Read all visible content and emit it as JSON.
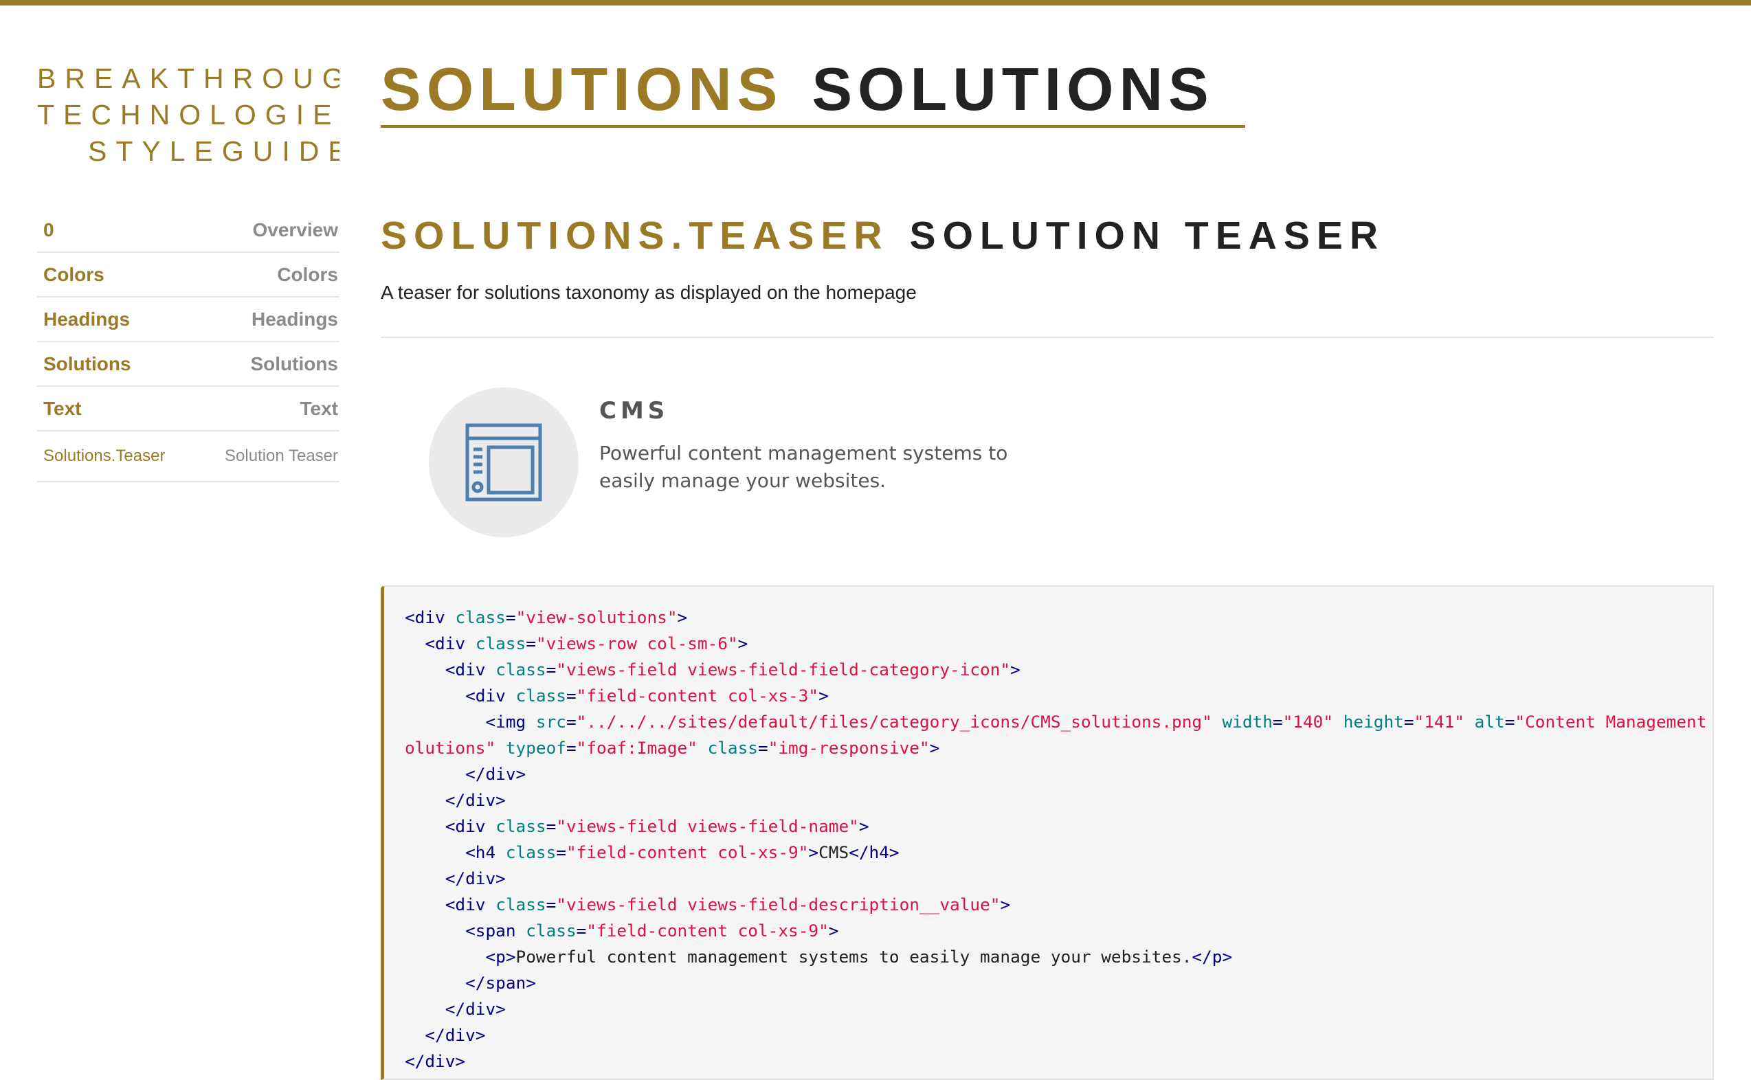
{
  "brand": {
    "line1": "BREAKTHROUGH",
    "line2": "TECHNOLOGIES",
    "line3": "STYLEGUIDE"
  },
  "nav": [
    {
      "key": "0",
      "label": "Overview"
    },
    {
      "key": "Colors",
      "label": "Colors"
    },
    {
      "key": "Headings",
      "label": "Headings"
    },
    {
      "key": "Solutions",
      "label": "Solutions"
    },
    {
      "key": "Text",
      "label": "Text"
    },
    {
      "key": "Solutions.Teaser",
      "label": "Solution Teaser"
    }
  ],
  "page": {
    "key": "SOLUTIONS",
    "title": "SOLUTIONS"
  },
  "section": {
    "key": "SOLUTIONS.TEASER",
    "title": "SOLUTION TEASER",
    "description": "A teaser for solutions taxonomy as displayed on the homepage"
  },
  "teaser": {
    "icon": "cms-window-icon",
    "title": "CMS",
    "text": "Powerful content management systems to easily manage your websites."
  },
  "code": {
    "lines": [
      [
        {
          "t": "tg",
          "v": "<div "
        },
        {
          "t": "at",
          "v": "class"
        },
        {
          "t": "tg",
          "v": "="
        },
        {
          "t": "vl",
          "v": "\"view-solutions\""
        },
        {
          "t": "tg",
          "v": ">"
        }
      ],
      [
        {
          "t": "p",
          "v": "  "
        },
        {
          "t": "tg",
          "v": "<div "
        },
        {
          "t": "at",
          "v": "class"
        },
        {
          "t": "tg",
          "v": "="
        },
        {
          "t": "vl",
          "v": "\"views-row col-sm-6\""
        },
        {
          "t": "tg",
          "v": ">"
        }
      ],
      [
        {
          "t": "p",
          "v": "    "
        },
        {
          "t": "tg",
          "v": "<div "
        },
        {
          "t": "at",
          "v": "class"
        },
        {
          "t": "tg",
          "v": "="
        },
        {
          "t": "vl",
          "v": "\"views-field views-field-field-category-icon\""
        },
        {
          "t": "tg",
          "v": ">"
        }
      ],
      [
        {
          "t": "p",
          "v": "      "
        },
        {
          "t": "tg",
          "v": "<div "
        },
        {
          "t": "at",
          "v": "class"
        },
        {
          "t": "tg",
          "v": "="
        },
        {
          "t": "vl",
          "v": "\"field-content col-xs-3\""
        },
        {
          "t": "tg",
          "v": ">"
        }
      ],
      [
        {
          "t": "p",
          "v": "        "
        },
        {
          "t": "tg",
          "v": "<img "
        },
        {
          "t": "at",
          "v": "src"
        },
        {
          "t": "tg",
          "v": "="
        },
        {
          "t": "vl",
          "v": "\"../../../sites/default/files/category_icons/CMS_solutions.png\""
        },
        {
          "t": "p",
          "v": " "
        },
        {
          "t": "at",
          "v": "width"
        },
        {
          "t": "tg",
          "v": "="
        },
        {
          "t": "vl",
          "v": "\"140\""
        },
        {
          "t": "p",
          "v": " "
        },
        {
          "t": "at",
          "v": "height"
        },
        {
          "t": "tg",
          "v": "="
        },
        {
          "t": "vl",
          "v": "\"141\""
        },
        {
          "t": "p",
          "v": " "
        },
        {
          "t": "at",
          "v": "alt"
        },
        {
          "t": "tg",
          "v": "="
        },
        {
          "t": "vl",
          "v": "\"Content Management S"
        }
      ],
      [
        {
          "t": "vl",
          "v": "olutions\""
        },
        {
          "t": "p",
          "v": " "
        },
        {
          "t": "at",
          "v": "typeof"
        },
        {
          "t": "tg",
          "v": "="
        },
        {
          "t": "vl",
          "v": "\"foaf:Image\""
        },
        {
          "t": "p",
          "v": " "
        },
        {
          "t": "at",
          "v": "class"
        },
        {
          "t": "tg",
          "v": "="
        },
        {
          "t": "vl",
          "v": "\"img-responsive\""
        },
        {
          "t": "tg",
          "v": ">"
        }
      ],
      [
        {
          "t": "p",
          "v": "      "
        },
        {
          "t": "tg",
          "v": "</div>"
        }
      ],
      [
        {
          "t": "p",
          "v": "    "
        },
        {
          "t": "tg",
          "v": "</div>"
        }
      ],
      [
        {
          "t": "p",
          "v": "    "
        },
        {
          "t": "tg",
          "v": "<div "
        },
        {
          "t": "at",
          "v": "class"
        },
        {
          "t": "tg",
          "v": "="
        },
        {
          "t": "vl",
          "v": "\"views-field views-field-name\""
        },
        {
          "t": "tg",
          "v": ">"
        }
      ],
      [
        {
          "t": "p",
          "v": "      "
        },
        {
          "t": "tg",
          "v": "<h4 "
        },
        {
          "t": "at",
          "v": "class"
        },
        {
          "t": "tg",
          "v": "="
        },
        {
          "t": "vl",
          "v": "\"field-content col-xs-9\""
        },
        {
          "t": "tg",
          "v": ">"
        },
        {
          "t": "p",
          "v": "CMS"
        },
        {
          "t": "tg",
          "v": "</h4>"
        }
      ],
      [
        {
          "t": "p",
          "v": "    "
        },
        {
          "t": "tg",
          "v": "</div>"
        }
      ],
      [
        {
          "t": "p",
          "v": "    "
        },
        {
          "t": "tg",
          "v": "<div "
        },
        {
          "t": "at",
          "v": "class"
        },
        {
          "t": "tg",
          "v": "="
        },
        {
          "t": "vl",
          "v": "\"views-field views-field-description__value\""
        },
        {
          "t": "tg",
          "v": ">"
        }
      ],
      [
        {
          "t": "p",
          "v": "      "
        },
        {
          "t": "tg",
          "v": "<span "
        },
        {
          "t": "at",
          "v": "class"
        },
        {
          "t": "tg",
          "v": "="
        },
        {
          "t": "vl",
          "v": "\"field-content col-xs-9\""
        },
        {
          "t": "tg",
          "v": ">"
        }
      ],
      [
        {
          "t": "p",
          "v": "        "
        },
        {
          "t": "tg",
          "v": "<p>"
        },
        {
          "t": "p",
          "v": "Powerful content management systems to easily manage your websites."
        },
        {
          "t": "tg",
          "v": "</p>"
        }
      ],
      [
        {
          "t": "p",
          "v": "      "
        },
        {
          "t": "tg",
          "v": "</span>"
        }
      ],
      [
        {
          "t": "p",
          "v": "    "
        },
        {
          "t": "tg",
          "v": "</div>"
        }
      ],
      [
        {
          "t": "p",
          "v": "  "
        },
        {
          "t": "tg",
          "v": "</div>"
        }
      ],
      [
        {
          "t": "tg",
          "v": "</div>"
        }
      ]
    ]
  },
  "colors": {
    "accent": "#9b7a26",
    "heading": "#222222",
    "nav_value": "#8a8a8a",
    "code_tag": "#000080",
    "code_attr": "#008080",
    "code_value": "#dd1144"
  }
}
